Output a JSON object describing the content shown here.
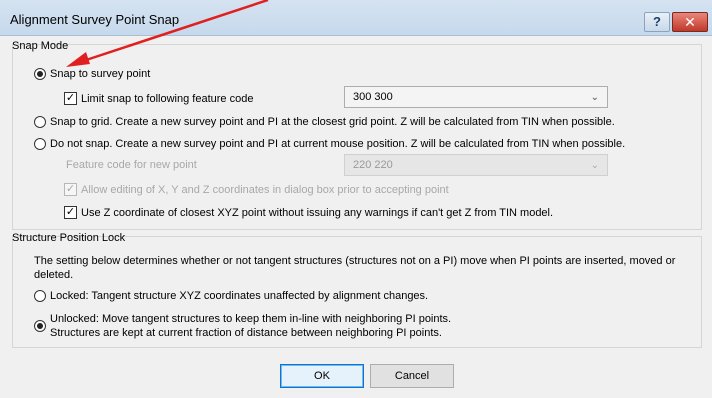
{
  "window": {
    "title": "Alignment Survey Point Snap",
    "help_label": "?",
    "close_label": "✕"
  },
  "snap_mode": {
    "label": "Snap Mode",
    "opt_survey": "Snap to survey point",
    "limit_label": "Limit snap to following feature code",
    "feature_code": "300 300",
    "opt_grid": "Snap to grid.  Create a new survey point and PI at the closest grid point.  Z will be calculated from TIN when possible.",
    "opt_nosnap": "Do not snap.  Create a new survey point and PI at current mouse position.  Z will be calculated from TIN when possible.",
    "new_code_label": "Feature code for new point",
    "new_code_value": "220 220",
    "allow_edit_label": "Allow editing of X, Y and Z coordinates in dialog box prior to accepting point",
    "use_z_label": "Use Z coordinate of closest XYZ point without issuing any warnings if can't get Z from TIN model."
  },
  "structure": {
    "label": "Structure Position Lock",
    "description": "The setting below determines whether or not tangent structures (structures not on a PI) move when PI points are inserted, moved or deleted.",
    "opt_locked": "Locked:  Tangent structure XYZ coordinates unaffected by alignment changes.",
    "opt_unlocked_1": "Unlocked: Move tangent structures to keep them in-line with neighboring PI points.",
    "opt_unlocked_2": "Structures are kept at current fraction of distance between neighboring PI points."
  },
  "buttons": {
    "ok": "OK",
    "cancel": "Cancel"
  },
  "icons": {
    "check_glyph": "✓"
  },
  "colors": {
    "annotation_arrow": "#e02020",
    "close_button": "#c0392b"
  }
}
